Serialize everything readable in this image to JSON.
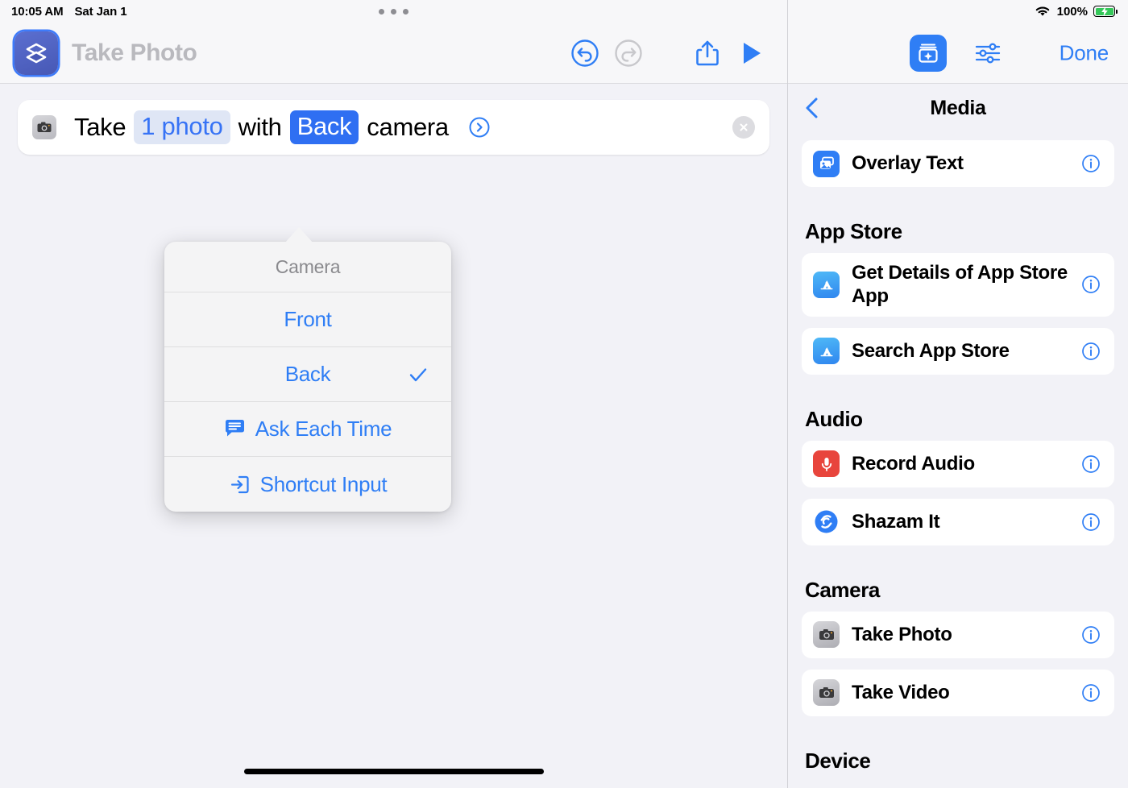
{
  "status_bar": {
    "time": "10:05 AM",
    "date": "Sat Jan 1",
    "battery_percent": "100%",
    "wifi_icon": "wifi-icon",
    "battery_icon": "battery-charging-icon",
    "multitask_icon": "multitasking-dots-icon"
  },
  "editor": {
    "app_icon": "shortcuts-icon",
    "title": "Take Photo",
    "toolbar": {
      "undo_label": "undo-icon",
      "redo_label": "redo-icon",
      "share_label": "share-icon",
      "play_label": "play-icon"
    },
    "action": {
      "icon": "camera-icon",
      "word_take": "Take",
      "token_count": "1 photo",
      "word_with": "with",
      "token_camera": "Back",
      "word_camera": "camera",
      "disclosure_icon": "chevron-right-circle-icon",
      "close_icon": "close-icon"
    },
    "popup": {
      "header": "Camera",
      "items": [
        {
          "label": "Front",
          "icon": "",
          "checked": false
        },
        {
          "label": "Back",
          "icon": "",
          "checked": true
        },
        {
          "label": "Ask Each Time",
          "icon": "ask-each-time-icon",
          "checked": false
        },
        {
          "label": "Shortcut Input",
          "icon": "shortcut-input-icon",
          "checked": false
        }
      ]
    }
  },
  "library": {
    "header": {
      "library_icon": "action-library-icon",
      "settings_icon": "sliders-icon",
      "done_label": "Done"
    },
    "nav": {
      "back_icon": "chevron-left-icon",
      "title": "Media"
    },
    "sections": [
      {
        "name": "",
        "items": [
          {
            "label": "Overlay Text",
            "icon": "overlay-text-icon",
            "icon_style": "ic-blue",
            "info": "info-icon"
          }
        ]
      },
      {
        "name": "App Store",
        "items": [
          {
            "label": "Get Details of App Store App",
            "icon": "app-store-icon",
            "icon_style": "ic-appstore",
            "info": "info-icon"
          },
          {
            "label": "Search App Store",
            "icon": "app-store-icon",
            "icon_style": "ic-appstore",
            "info": "info-icon"
          }
        ]
      },
      {
        "name": "Audio",
        "items": [
          {
            "label": "Record Audio",
            "icon": "microphone-icon",
            "icon_style": "ic-red",
            "info": "info-icon"
          },
          {
            "label": "Shazam It",
            "icon": "shazam-icon",
            "icon_style": "ic-shazam",
            "info": "info-icon"
          }
        ]
      },
      {
        "name": "Camera",
        "items": [
          {
            "label": "Take Photo",
            "icon": "camera-icon",
            "icon_style": "ic-gray",
            "info": "info-icon"
          },
          {
            "label": "Take Video",
            "icon": "camera-icon",
            "icon_style": "ic-gray",
            "info": "info-icon"
          }
        ]
      },
      {
        "name": "Device",
        "items": []
      }
    ]
  },
  "colors": {
    "accent_blue": "#2f7ef5",
    "token_solid_blue": "#2f6ff2",
    "token_light_blue_bg": "#dfe6f5",
    "background": "#f2f2f7",
    "card": "#ffffff",
    "battery_green": "#34c759",
    "record_red": "#e8453c"
  }
}
